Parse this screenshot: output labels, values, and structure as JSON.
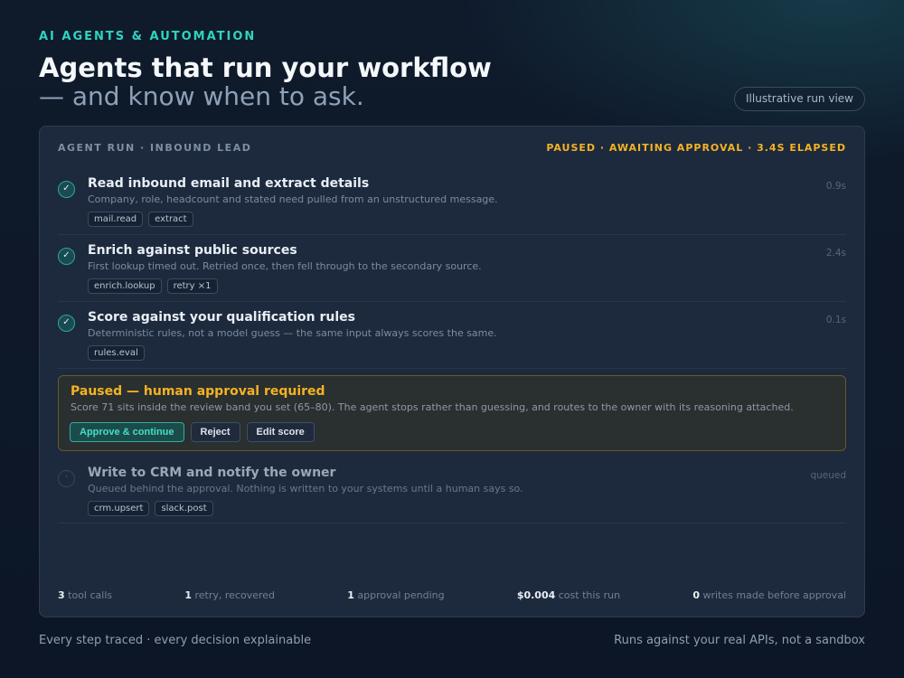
{
  "header": {
    "eyebrow": "AI AGENTS & AUTOMATION",
    "title": "Agents that run your workflow",
    "subtitle": "— and know when to ask.",
    "pill": "Illustrative run view"
  },
  "panel": {
    "label": "AGENT RUN · INBOUND LEAD",
    "status": "PAUSED · AWAITING APPROVAL · 3.4S ELAPSED",
    "steps": [
      {
        "title": "Read inbound email and extract details",
        "desc": "Company, role, headcount and stated need pulled from an unstructured message.",
        "time": "0.9s",
        "tags": [
          "mail.read",
          "extract"
        ],
        "icon": "check-icon"
      },
      {
        "title": "Enrich against public sources",
        "desc": "First lookup timed out. Retried once, then fell through to the secondary source.",
        "time": "2.4s",
        "tags": [
          "enrich.lookup",
          "retry ×1"
        ],
        "icon": "check-icon"
      },
      {
        "title": "Score against your qualification rules",
        "desc": "Deterministic rules, not a model guess — the same input always scores the same.",
        "time": "0.1s",
        "tags": [
          "rules.eval"
        ],
        "icon": "check-icon"
      }
    ],
    "approval": {
      "title": "Paused — human approval required",
      "desc": "Score 71 sits inside the review band you set (65–80). The agent stops rather than guessing, and routes to the owner with its reasoning attached.",
      "buttons": {
        "approve": "Approve & continue",
        "reject": "Reject",
        "edit": "Edit score"
      }
    },
    "queued_step": {
      "title": "Write to CRM and notify the owner",
      "desc": "Queued behind the approval. Nothing is written to your systems until a human says so.",
      "time": "queued",
      "tags": [
        "crm.upsert",
        "slack.post"
      ],
      "icon": "pending-dot-icon"
    },
    "stats": [
      {
        "value": "3",
        "label": " tool calls"
      },
      {
        "value": "1",
        "label": " retry, recovered"
      },
      {
        "value": "1",
        "label": " approval pending"
      },
      {
        "value": "$0.004",
        "label": " cost this run"
      },
      {
        "value": "0",
        "label": " writes made before approval"
      }
    ]
  },
  "footer": {
    "left": "Every step traced · every decision explainable",
    "right": "Runs against your real APIs, not a sandbox"
  },
  "colors": {
    "accent": "#2dd4bf",
    "warning": "#f4b323",
    "background": "#0f1a2b",
    "panel": "#1d2a3d"
  }
}
